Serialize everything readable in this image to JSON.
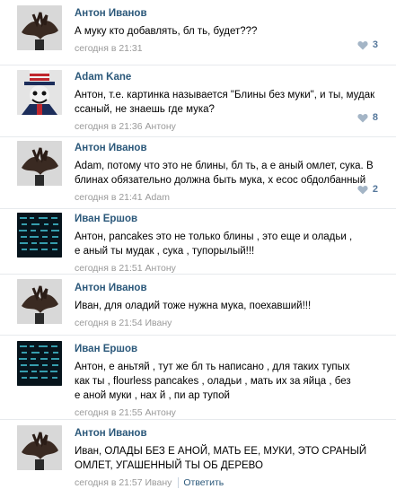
{
  "comments": [
    {
      "author": "Антон Иванов",
      "avatar": "anton",
      "lines": [
        "А муку кто добавлять, бл  ть, будет???"
      ],
      "meta": "сегодня в 21:31",
      "likes": "3"
    },
    {
      "author": "Adam Kane",
      "avatar": "adam",
      "lines": [
        "Антон, т.е. картинка называется \"Блины без муки\", и ты, мудак",
        "ссаный, не знаешь где мука?"
      ],
      "meta": "сегодня в 21:36 Антону",
      "likes": "8"
    },
    {
      "author": "Антон Иванов",
      "avatar": "anton",
      "lines": [
        "Adam, потому что это не блины, бл  ть, а е  аный омлет, сука. В",
        "блинах обязательно должна быть мука, х  есос обдолбанный"
      ],
      "meta": "сегодня в 21:41 Adam",
      "likes": "2"
    },
    {
      "author": "Иван Ершов",
      "avatar": "ivan",
      "lines": [
        "Антон, pancakes это не только блины , это еще и оладьи ,",
        "е  аный ты мудак , сука , тупорылый!!!"
      ],
      "meta": "сегодня в 21:51 Антону",
      "likes": ""
    },
    {
      "author": "Антон Иванов",
      "avatar": "anton",
      "lines": [
        "Иван, для оладий тоже нужна мука, поехавший!!!"
      ],
      "meta": "сегодня в 21:54 Ивану",
      "likes": ""
    },
    {
      "author": "Иван Ершов",
      "avatar": "ivan",
      "lines": [
        "Антон, е  аньтяй , тут же бл  ть написано , для таких тупых",
        "как ты , flourless pancakes , оладьи , мать их за яйца , без",
        "е  аной муки , нах  й , пи  ар тупой"
      ],
      "meta": "сегодня в 21:55 Антону",
      "likes": ""
    },
    {
      "author": "Антон Иванов",
      "avatar": "anton",
      "lines": [
        "Иван, ОЛАДЫ БЕЗ Е  АНОЙ, МАТЬ ЕЕ, МУКИ, ЭТО СРАНЫЙ",
        "ОМЛЕТ, УГАШЕННЫЙ ТЫ ОБ  ДЕРЕВО"
      ],
      "meta": "сегодня в 21:57 Ивану",
      "reply": "Ответить",
      "likes": ""
    }
  ],
  "colors": {
    "author": "#2b587a",
    "meta": "#999999",
    "likes": "#55779b"
  }
}
